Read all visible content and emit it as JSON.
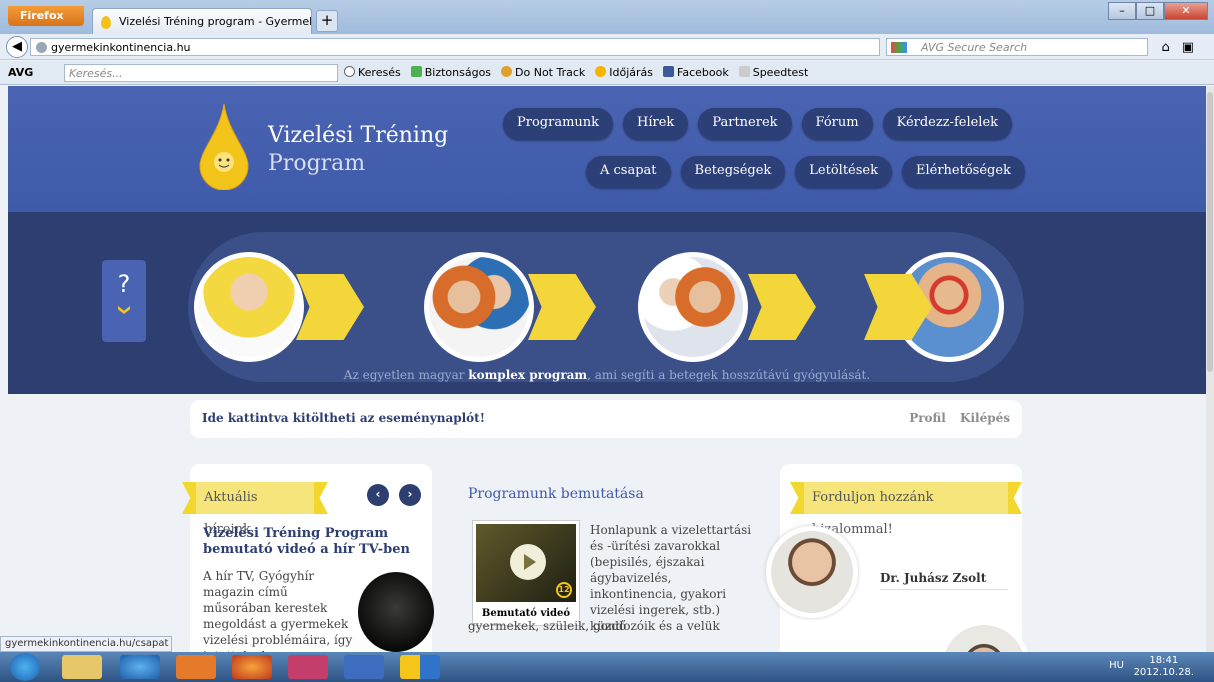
{
  "browser": {
    "app_button": "Firefox",
    "tab_title": "Vizelési Tréning program - Gyermekinko...",
    "new_tab": "+",
    "url": "gyermekinkontinencia.hu",
    "search_placeholder": "AVG Secure Search",
    "toolbar": {
      "brand": "AVG",
      "search_placeholder": "Keresés...",
      "items": [
        "Keresés",
        "Biztonságos",
        "Do Not Track",
        "Időjárás",
        "Facebook",
        "Speedtest"
      ]
    },
    "status_url": "gyermekinkontinencia.hu/csapat"
  },
  "site": {
    "logo_line1": "Vizelési Tréning",
    "logo_line2": "Program",
    "nav_row1": [
      "Programunk",
      "Hírek",
      "Partnerek",
      "Fórum",
      "Kérdezz-felelek"
    ],
    "nav_row2": [
      "A csapat",
      "Betegségek",
      "Letöltések",
      "Elérhetőségek"
    ],
    "help_mark": "?",
    "tagline_pre": "Az egyetlen magyar",
    "tagline_bold": "komplex program",
    "tagline_post": ", ami segíti a betegek hosszútávú gyógyulását.",
    "event_link": "Ide kattintva kitöltheti az eseménynaplót!",
    "profile": "Profil",
    "logout": "Kilépés"
  },
  "news": {
    "tag": "Aktuális híreink",
    "prev": "‹",
    "next": "›",
    "title": "Vizelési Tréning Program bemutató videó a hír TV-ben",
    "text": "A hír TV, Gyógyhír magazin című műsorában kerestek megoldást a gyermekek vizelési problémáira, így jutottak el"
  },
  "program": {
    "title": "Programunk bemutatása",
    "video_caption": "Bemutató videó",
    "video_badge": "12",
    "text": "Honlapunk a vizelettartási és -ürítési zavarokkal (bepisilés, éjszakai ágybavizelés, inkontinencia, gyakori vizelési ingerek, stb.) küzdő",
    "text2": "gyermekek, szüleik, gondozóik és a velük"
  },
  "contact": {
    "tag": "Forduljon hozzánk bizalommal!",
    "doctor": "Dr. Juhász Zsolt"
  },
  "taskbar": {
    "lang": "HU",
    "time": "18:41",
    "date": "2012.10.28."
  }
}
